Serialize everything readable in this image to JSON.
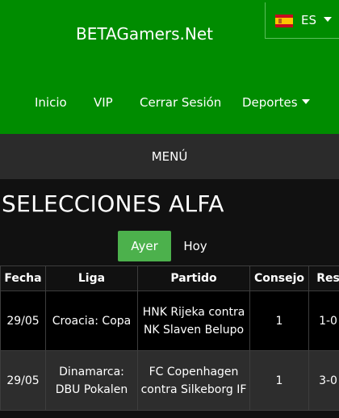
{
  "header": {
    "site_title": "BETAGamers.Net",
    "language": {
      "label": "ES",
      "flag": "spain-flag-icon"
    },
    "colors": {
      "header_bg": "#008c00",
      "active_tab": "#4cb14c",
      "menubar_bg": "#2b2b2b",
      "page_bg": "#111111"
    }
  },
  "nav": {
    "items": [
      {
        "label": "Inicio"
      },
      {
        "label": "VIP"
      },
      {
        "label": "Cerrar Sesión"
      },
      {
        "label": "Deportes"
      }
    ]
  },
  "menubar": {
    "label": "MENÚ"
  },
  "main": {
    "title": "SELECCIONES ALFA",
    "tabs": [
      {
        "label": "Ayer",
        "active": true
      },
      {
        "label": "Hoy",
        "active": false
      }
    ],
    "table": {
      "columns": [
        "Fecha",
        "Liga",
        "Partido",
        "Consejo",
        "Res"
      ],
      "rows": [
        {
          "fecha": "29/05",
          "liga": "Croacia: Copa",
          "partido": "HNK Rijeka contra NK Slaven Belupo",
          "consejo": "1",
          "res": "1-0"
        },
        {
          "fecha": "29/05",
          "liga": "Dinamarca: DBU Pokalen",
          "partido": "FC Copenhagen contra Silkeborg IF",
          "consejo": "1",
          "res": "3-0"
        }
      ]
    }
  }
}
